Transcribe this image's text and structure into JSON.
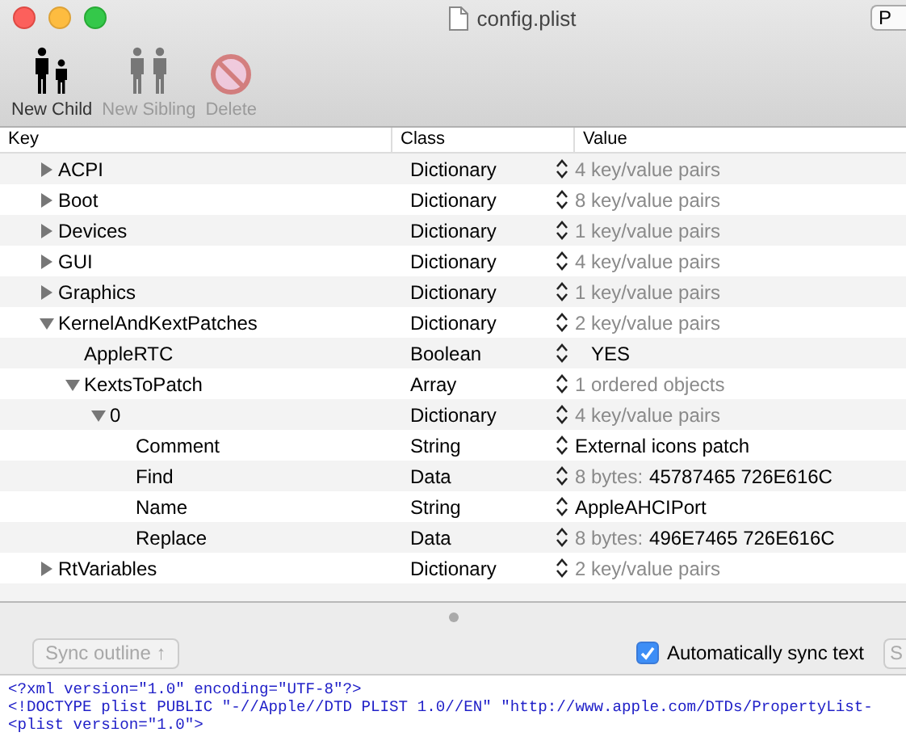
{
  "window": {
    "title": "config.plist",
    "corner_button": "P"
  },
  "toolbar": [
    {
      "label": "New Child",
      "kind": "child",
      "disabled": false
    },
    {
      "label": "New Sibling",
      "kind": "sibling",
      "disabled": true
    },
    {
      "label": "Delete",
      "kind": "delete",
      "disabled": true
    }
  ],
  "outline": {
    "columns": [
      "Key",
      "Class",
      "Value"
    ],
    "rows": [
      {
        "key": "ACPI",
        "class": "Dictionary",
        "kind": "summary",
        "value": "4 key/value pairs",
        "expanded": false
      },
      {
        "key": "Boot",
        "class": "Dictionary",
        "kind": "summary",
        "value": "8 key/value pairs",
        "expanded": false
      },
      {
        "key": "Devices",
        "class": "Dictionary",
        "kind": "summary",
        "value": "1 key/value pairs",
        "expanded": false
      },
      {
        "key": "GUI",
        "class": "Dictionary",
        "kind": "summary",
        "value": "4 key/value pairs",
        "expanded": false
      },
      {
        "key": "Graphics",
        "class": "Dictionary",
        "kind": "summary",
        "value": "1 key/value pairs",
        "expanded": false
      },
      {
        "key": "KernelAndKextPatches",
        "class": "Dictionary",
        "kind": "summary",
        "value": "2 key/value pairs",
        "expanded": true,
        "children": [
          {
            "key": "AppleRTC",
            "class": "Boolean",
            "kind": "boolean",
            "value": "YES"
          },
          {
            "key": "KextsToPatch",
            "class": "Array",
            "kind": "summary",
            "value": "1 ordered objects",
            "expanded": true,
            "children": [
              {
                "key": "0",
                "class": "Dictionary",
                "kind": "summary",
                "value": "4 key/value pairs",
                "expanded": true,
                "children": [
                  {
                    "key": "Comment",
                    "class": "String",
                    "kind": "plain",
                    "value": "External icons patch"
                  },
                  {
                    "key": "Find",
                    "class": "Data",
                    "kind": "data",
                    "value_prefix": "8 bytes:",
                    "value": "45787465 726E616C"
                  },
                  {
                    "key": "Name",
                    "class": "String",
                    "kind": "plain",
                    "value": "AppleAHCIPort"
                  },
                  {
                    "key": "Replace",
                    "class": "Data",
                    "kind": "data",
                    "value_prefix": "8 bytes:",
                    "value": "496E7465 726E616C"
                  }
                ]
              }
            ]
          }
        ]
      },
      {
        "key": "RtVariables",
        "class": "Dictionary",
        "kind": "summary",
        "value": "2 key/value pairs",
        "expanded": false
      }
    ]
  },
  "sync_bar": {
    "sync_button": {
      "label": "Sync outline ↑",
      "disabled": true
    },
    "auto_sync": {
      "label": "Automatically sync text",
      "checked": true
    },
    "corner_button": "S"
  },
  "text_editor": {
    "lines": [
      "<?xml version=\"1.0\" encoding=\"UTF-8\"?>",
      "<!DOCTYPE plist PUBLIC \"-//Apple//DTD PLIST 1.0//EN\" \"http://www.apple.com/DTDs/PropertyList-",
      "<plist version=\"1.0\">"
    ]
  }
}
